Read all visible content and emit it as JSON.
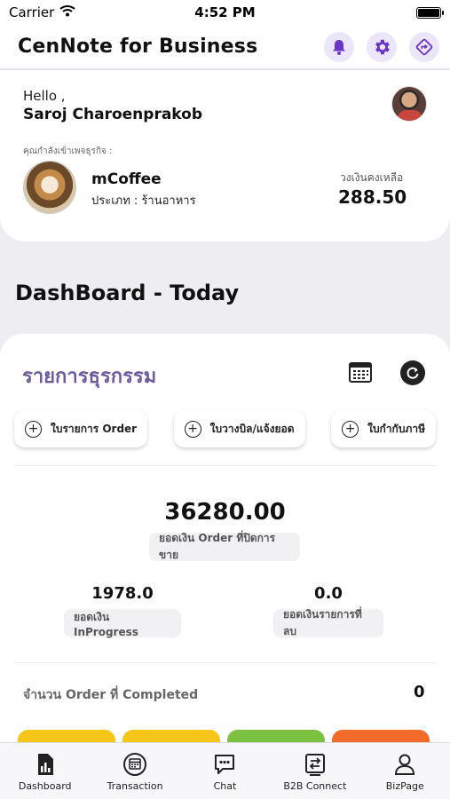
{
  "status_bar": {
    "carrier": "Carrier",
    "time": "4:52 PM"
  },
  "app_bar": {
    "title": "CenNote for Business",
    "icons": [
      "bell-icon",
      "gear-icon",
      "share-diamond-icon"
    ],
    "icon_tint": "#6b35c8",
    "icon_bg": "#ece6fb"
  },
  "profile": {
    "greeting": "Hello ,",
    "user_name": "Saroj Charoenprakob",
    "business_caption": "คุณกำลังเข้าเพจธุรกิจ :",
    "business_name": "mCoffee",
    "business_type": "ประเภท : ร้านอาหาร",
    "credit_label": "วงเงินคงเหลือ",
    "credit_value": "288.50"
  },
  "dashboard": {
    "title": "DashBoard - Today",
    "section_title": "รายการธุรกรรม",
    "section_title_color": "#6b5b9e",
    "quick_actions": [
      {
        "label": "ใบรายการ Order"
      },
      {
        "label": "ใบวางบิล/แจ้งยอด"
      },
      {
        "label": "ใบกำกับภาษี"
      }
    ],
    "order_total": {
      "value": "36280.00",
      "label": "ยอดเงิน Order ที่ปิดการขาย"
    },
    "in_progress": {
      "value": "1978.0",
      "label": "ยอดเงิน InProgress"
    },
    "deleted": {
      "value": "0.0",
      "label": "ยอดเงินรายการที่ลบ"
    },
    "completed": {
      "label": "จำนวน Order ที่ Completed",
      "value": "0"
    },
    "status_colors": [
      "#f5c518",
      "#f5c518",
      "#7cc242",
      "#f26b2a"
    ]
  },
  "tab_bar": {
    "tabs": [
      {
        "label": "Dashboard",
        "icon": "chart-doc-icon"
      },
      {
        "label": "Transaction",
        "icon": "calendar-circle-icon"
      },
      {
        "label": "Chat",
        "icon": "chat-bubble-icon"
      },
      {
        "label": "B2B Connect",
        "icon": "exchange-icon"
      },
      {
        "label": "BizPage",
        "icon": "person-icon"
      }
    ]
  }
}
